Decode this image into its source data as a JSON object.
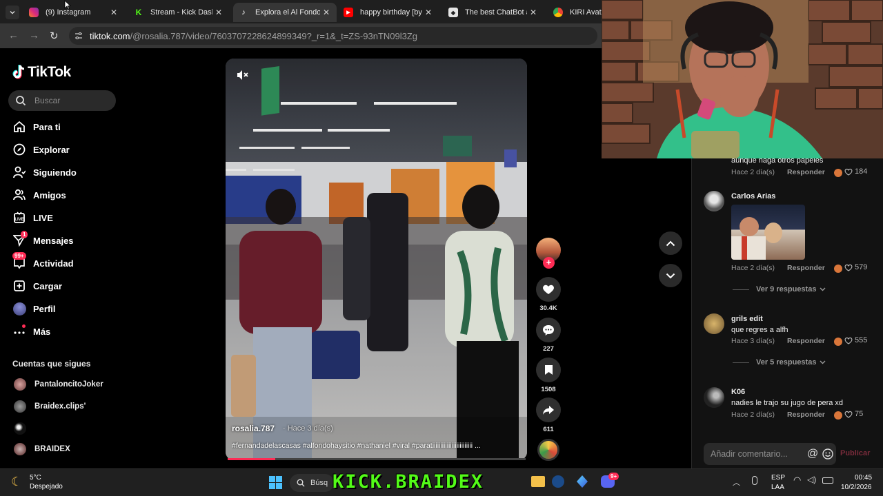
{
  "browser": {
    "tabs": [
      {
        "title": "(9) Instagram",
        "icon": "instagram-icon",
        "color": "#e1306c"
      },
      {
        "title": "Stream - Kick Dashbo",
        "icon": "kick-icon",
        "color": "#53fc18"
      },
      {
        "title": "Explora el Al Fondo H",
        "icon": "tiktok-icon",
        "color": "#000000"
      },
      {
        "title": "happy birthday [by d",
        "icon": "youtube-icon",
        "color": "#ff0000"
      },
      {
        "title": "The best ChatBot anc",
        "icon": "chatbot-icon",
        "color": "#ffffff"
      },
      {
        "title": "KIRI Avatar",
        "icon": "chrome-icon",
        "color": "#4285f4"
      }
    ],
    "url_host": "tiktok.com",
    "url_path": "/@rosalia.787/video/7603707228624899349?_r=1&_t=ZS-93nTN09l3Zg"
  },
  "sidebar": {
    "logo": "TikTok",
    "search_placeholder": "Buscar",
    "nav": [
      {
        "label": "Para ti",
        "icon": "home-icon"
      },
      {
        "label": "Explorar",
        "icon": "compass-icon"
      },
      {
        "label": "Siguiendo",
        "icon": "following-icon"
      },
      {
        "label": "Amigos",
        "icon": "friends-icon"
      },
      {
        "label": "LIVE",
        "icon": "live-icon"
      },
      {
        "label": "Mensajes",
        "icon": "messages-icon",
        "badge": "1"
      },
      {
        "label": "Actividad",
        "icon": "activity-icon",
        "badge": "99+"
      },
      {
        "label": "Cargar",
        "icon": "upload-icon"
      },
      {
        "label": "Perfil",
        "icon": "profile-icon"
      },
      {
        "label": "Más",
        "icon": "more-icon"
      }
    ],
    "following_title": "Cuentas que sigues",
    "following": [
      "PantaloncitoJoker",
      "Braidex.clips'",
      "",
      "BRAIDEX"
    ]
  },
  "video": {
    "author": "rosalia.787",
    "time": "· Hace 3 día(s)",
    "tags": "#fernandadelascasas #alfondohaysitio #nathaniel #viral #paratiiiiiiiiiiiiiiiiiiiiiiiii ...",
    "progress": 0.16
  },
  "actions": {
    "likes": "30.4K",
    "comments": "227",
    "saves": "1508",
    "shares": "611"
  },
  "comments": [
    {
      "text": "aunque haga otros papeles",
      "meta": "Hace 2 día(s)",
      "reply": "Responder",
      "likes": "184"
    },
    {
      "name": "Carlos Arias",
      "meta": "Hace 2 día(s)",
      "reply": "Responder",
      "likes": "579",
      "more": "Ver 9 respuestas"
    },
    {
      "name": "grils edit",
      "text": "que regres a alfh",
      "meta": "Hace 3 día(s)",
      "reply": "Responder",
      "likes": "555",
      "more": "Ver 5 respuestas"
    },
    {
      "name": "K06",
      "text": "nadies le trajo su jugo de pera xd",
      "meta": "Hace 2 día(s)",
      "reply": "Responder",
      "likes": "75"
    }
  ],
  "comment_input": {
    "placeholder": "Añadir comentario...",
    "publish": "Publicar"
  },
  "taskbar": {
    "weather_temp": "5°C",
    "weather_desc": "Despejado",
    "search": "Búsq",
    "banner": "KICK.BRAIDEX",
    "lang1": "ESP",
    "lang2": "LAA",
    "time": "00:45",
    "date": "10/2/2026",
    "discord_badge": "9+"
  },
  "colors": {
    "accent": "#fe2c55",
    "kick": "#53fc18"
  }
}
